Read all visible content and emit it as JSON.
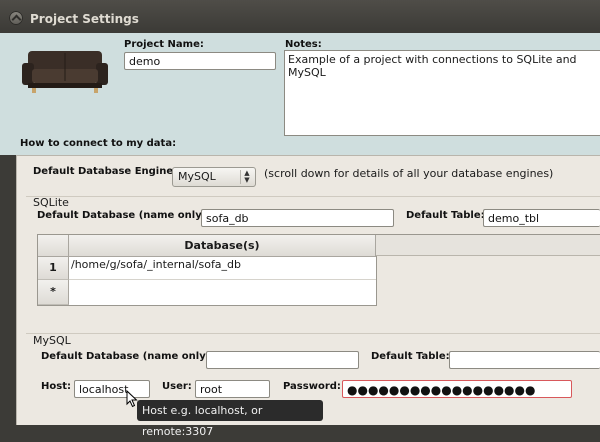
{
  "window": {
    "title": "Project Settings"
  },
  "project": {
    "name_label": "Project Name:",
    "name_value": "demo",
    "notes_label": "Notes:",
    "notes_value": "Example of a project with connections to SQLite and MySQL"
  },
  "connect": {
    "heading": "How to connect to my data:",
    "engine_label": "Default Database Engine:",
    "engine_value": "MySQL",
    "engine_hint": "(scroll down for details of all your database engines)"
  },
  "sqlite": {
    "group_label": "SQLite",
    "default_db_label": "Default Database (name only):",
    "default_db_value": "sofa_db",
    "default_table_label": "Default Table:",
    "default_table_value": "demo_tbl",
    "grid": {
      "column_header": "Database(s)",
      "rows": [
        {
          "row_label": "1",
          "value": "/home/g/sofa/_internal/sofa_db"
        },
        {
          "row_label": "*",
          "value": ""
        }
      ]
    }
  },
  "mysql": {
    "group_label": "MySQL",
    "default_db_label": "Default Database (name only):",
    "default_db_value": "",
    "default_table_label": "Default Table:",
    "default_table_value": "",
    "host_label": "Host:",
    "host_value": "localhost",
    "user_label": "User:",
    "user_value": "root",
    "password_label": "Password:",
    "password_value": "●●●●●●●●●●●●●●●●●●"
  },
  "tooltip": {
    "text": "Host e.g. localhost, or remote:3307"
  },
  "icons": {
    "close": "close-icon",
    "sofa": "sofa-image",
    "cursor": "mouse-pointer-icon",
    "spinner": "updown-arrows-icon"
  },
  "colors": {
    "titlebar": "#3c3b37",
    "header_panel": "#cfdede",
    "section_panel": "#ece8e1",
    "password_border": "#d8585b",
    "tooltip_bg": "#2b2b2b"
  }
}
